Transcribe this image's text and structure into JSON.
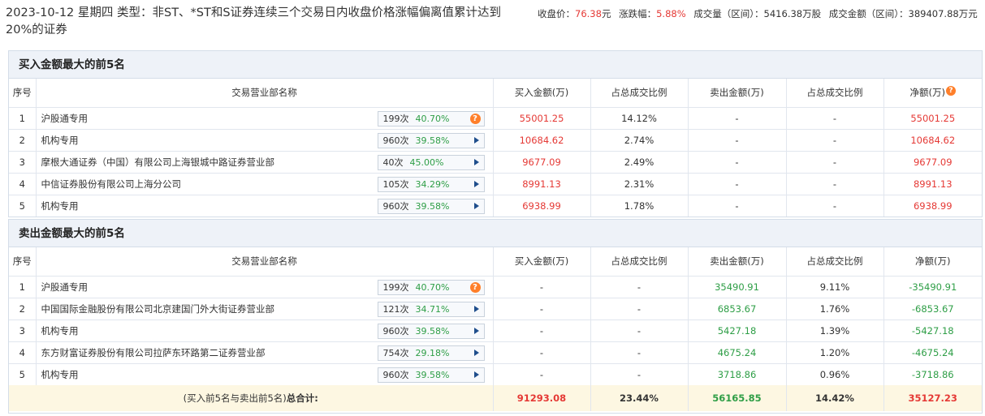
{
  "header": {
    "title": "2023-10-12 星期四 类型：非ST、*ST和S证券连续三个交易日内收盘价格涨幅偏离值累计达到20%的证券",
    "close_label": "收盘价：",
    "close_value": "76.38",
    "close_unit": "元",
    "change_label": "涨跌幅：",
    "change_value": "5.88%",
    "volume": "成交量（区间）：5416.38万股",
    "amount": "成交金额（区间）：389407.88万元"
  },
  "buy": {
    "title": "买入金额最大的前5名",
    "columns": [
      "序号",
      "交易营业部名称",
      "买入金额(万)",
      "占总成交比例",
      "卖出金额(万)",
      "占总成交比例",
      "净额(万)"
    ],
    "rows": [
      {
        "no": "1",
        "name": "沪股通专用",
        "times": "199次",
        "rate": "40.70%",
        "icon": "question",
        "buy": "55001.25",
        "buy_ratio": "14.12%",
        "sell": "-",
        "sell_ratio": "-",
        "net": "55001.25"
      },
      {
        "no": "2",
        "name": "机构专用",
        "times": "960次",
        "rate": "39.58%",
        "icon": "arrow",
        "buy": "10684.62",
        "buy_ratio": "2.74%",
        "sell": "-",
        "sell_ratio": "-",
        "net": "10684.62"
      },
      {
        "no": "3",
        "name": "摩根大通证券（中国）有限公司上海银城中路证券营业部",
        "times": "40次",
        "rate": "45.00%",
        "icon": "arrow",
        "buy": "9677.09",
        "buy_ratio": "2.49%",
        "sell": "-",
        "sell_ratio": "-",
        "net": "9677.09"
      },
      {
        "no": "4",
        "name": "中信证券股份有限公司上海分公司",
        "times": "105次",
        "rate": "34.29%",
        "icon": "arrow",
        "buy": "8991.13",
        "buy_ratio": "2.31%",
        "sell": "-",
        "sell_ratio": "-",
        "net": "8991.13"
      },
      {
        "no": "5",
        "name": "机构专用",
        "times": "960次",
        "rate": "39.58%",
        "icon": "arrow",
        "buy": "6938.99",
        "buy_ratio": "1.78%",
        "sell": "-",
        "sell_ratio": "-",
        "net": "6938.99"
      }
    ]
  },
  "sell": {
    "title": "卖出金额最大的前5名",
    "columns": [
      "序号",
      "交易营业部名称",
      "买入金额(万)",
      "占总成交比例",
      "卖出金额(万)",
      "占总成交比例",
      "净额(万)"
    ],
    "rows": [
      {
        "no": "1",
        "name": "沪股通专用",
        "times": "199次",
        "rate": "40.70%",
        "icon": "question",
        "buy": "-",
        "buy_ratio": "-",
        "sell": "35490.91",
        "sell_ratio": "9.11%",
        "net": "-35490.91"
      },
      {
        "no": "2",
        "name": "中国国际金融股份有限公司北京建国门外大街证券营业部",
        "times": "121次",
        "rate": "34.71%",
        "icon": "arrow",
        "buy": "-",
        "buy_ratio": "-",
        "sell": "6853.67",
        "sell_ratio": "1.76%",
        "net": "-6853.67"
      },
      {
        "no": "3",
        "name": "机构专用",
        "times": "960次",
        "rate": "39.58%",
        "icon": "arrow",
        "buy": "-",
        "buy_ratio": "-",
        "sell": "5427.18",
        "sell_ratio": "1.39%",
        "net": "-5427.18"
      },
      {
        "no": "4",
        "name": "东方财富证券股份有限公司拉萨东环路第二证券营业部",
        "times": "754次",
        "rate": "29.18%",
        "icon": "arrow",
        "buy": "-",
        "buy_ratio": "-",
        "sell": "4675.24",
        "sell_ratio": "1.20%",
        "net": "-4675.24"
      },
      {
        "no": "5",
        "name": "机构专用",
        "times": "960次",
        "rate": "39.58%",
        "icon": "arrow",
        "buy": "-",
        "buy_ratio": "-",
        "sell": "3718.86",
        "sell_ratio": "0.96%",
        "net": "-3718.86"
      }
    ],
    "total": {
      "label_prefix": "(买入前5名与卖出前5名)",
      "label_bold": "总合计:",
      "buy": "91293.08",
      "buy_ratio": "23.44%",
      "sell": "56165.85",
      "sell_ratio": "14.42%",
      "net": "35127.23"
    }
  },
  "colors": {
    "positive": "#e53935",
    "negative": "#2e9e46",
    "accent": "#ff7f2a"
  }
}
